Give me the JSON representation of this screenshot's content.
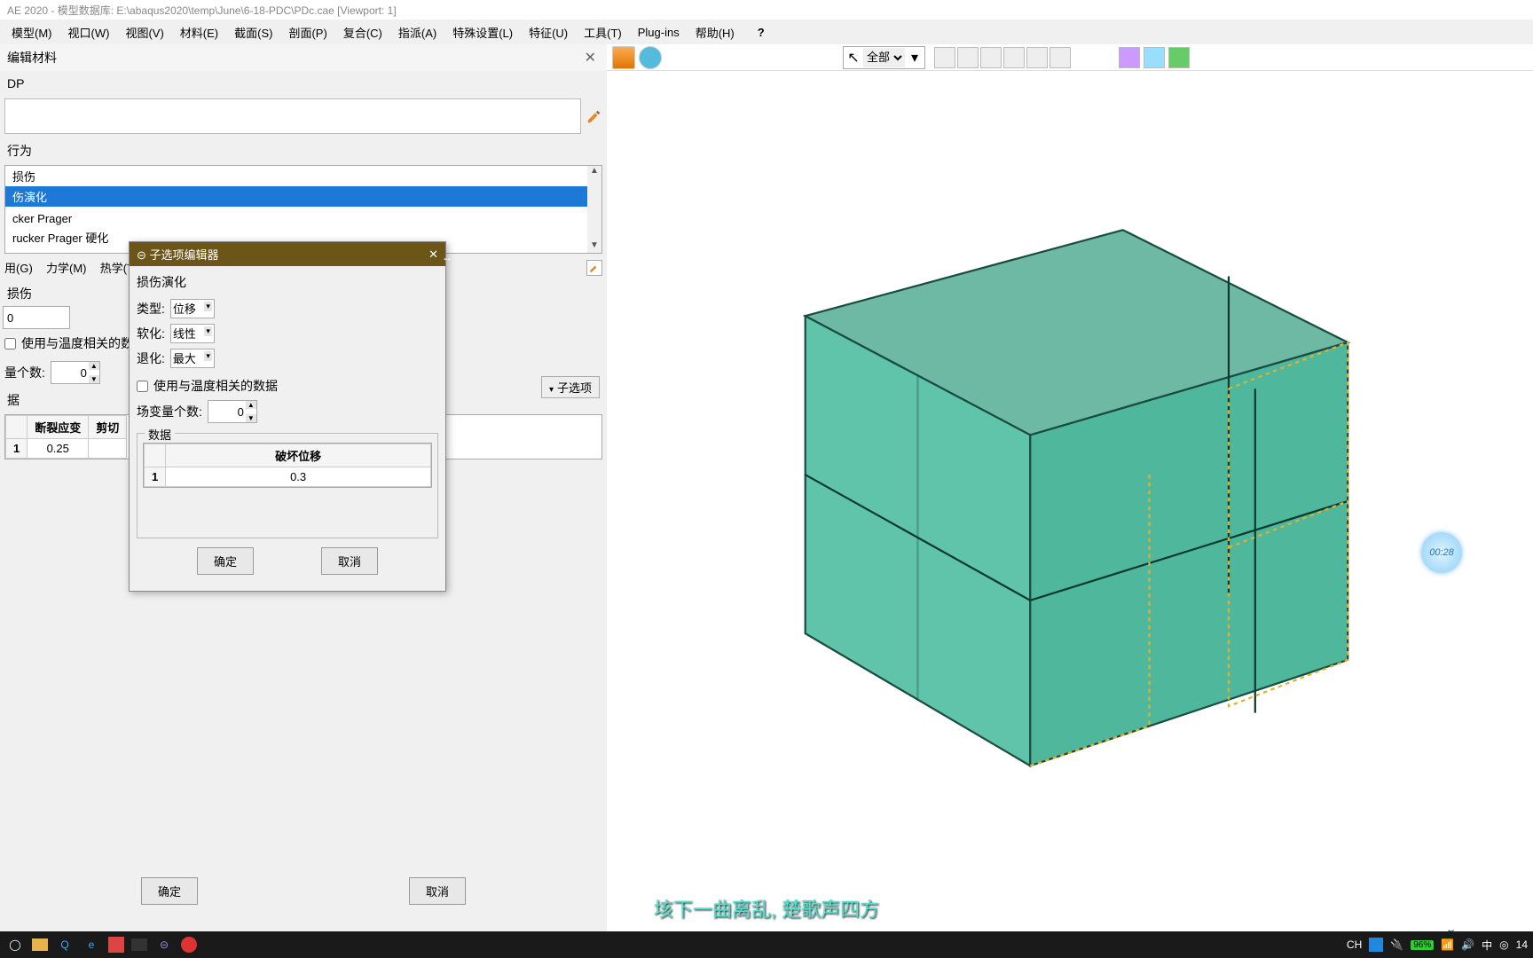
{
  "title": "AE 2020 - 模型数据库: E:\\abaqus2020\\temp\\June\\6-18-PDC\\PDc.cae [Viewport: 1]",
  "menu": {
    "model": "模型(M)",
    "view": "视口(W)",
    "viewtu": "视图(V)",
    "material": "材料(E)",
    "section": "截面(S)",
    "profile": "剖面(P)",
    "assembly": "复合(C)",
    "assign": "指派(A)",
    "special": "特殊设置(L)",
    "feature": "特征(U)",
    "tool": "工具(T)",
    "plugins": "Plug-ins",
    "help": "帮助(H)"
  },
  "material_editor": {
    "title": "编辑材料",
    "name_label": "DP",
    "behavior_label": "行为",
    "behaviors": [
      "损伤",
      "伤演化",
      "",
      "cker Prager",
      "rucker Prager 硬化"
    ],
    "selected_behavior_index": 1,
    "category_tabs": {
      "general": "用(G)",
      "mechanics": "力学(M)",
      "thermal": "热学(T)"
    },
    "damage_section": "损伤",
    "damage_input": "0",
    "temp_check": "使用与温度相关的数据",
    "field_var_label": "量个数:",
    "field_var_value": "0",
    "data_label": "据",
    "table": {
      "headers": [
        "断裂应变",
        "剪切"
      ],
      "row": [
        "1",
        "0.25"
      ]
    },
    "suboption_btn": "子选项",
    "ok": "确定",
    "cancel": "取消"
  },
  "sub_dialog": {
    "title": "子选项编辑器",
    "section": "损伤演化",
    "type_label": "类型:",
    "type_value": "位移",
    "soft_label": "软化:",
    "soft_value": "线性",
    "deg_label": "退化:",
    "deg_value": "最大",
    "temp_check": "使用与温度相关的数据",
    "fv_label": "场变量个数:",
    "fv_value": "0",
    "data_group": "数据",
    "table": {
      "header": "破坏位移",
      "row": [
        "1",
        "0.3"
      ]
    },
    "ok": "确定",
    "cancel": "取消"
  },
  "rp_toolbar": {
    "scope": "全部"
  },
  "simulia": "SIMUL",
  "timer": "00:28",
  "subtitle": "垓下一曲离乱, 楚歌声四方",
  "taskbar": {
    "lang": "CH",
    "battery": "96%",
    "ime": "中",
    "time": "14"
  }
}
